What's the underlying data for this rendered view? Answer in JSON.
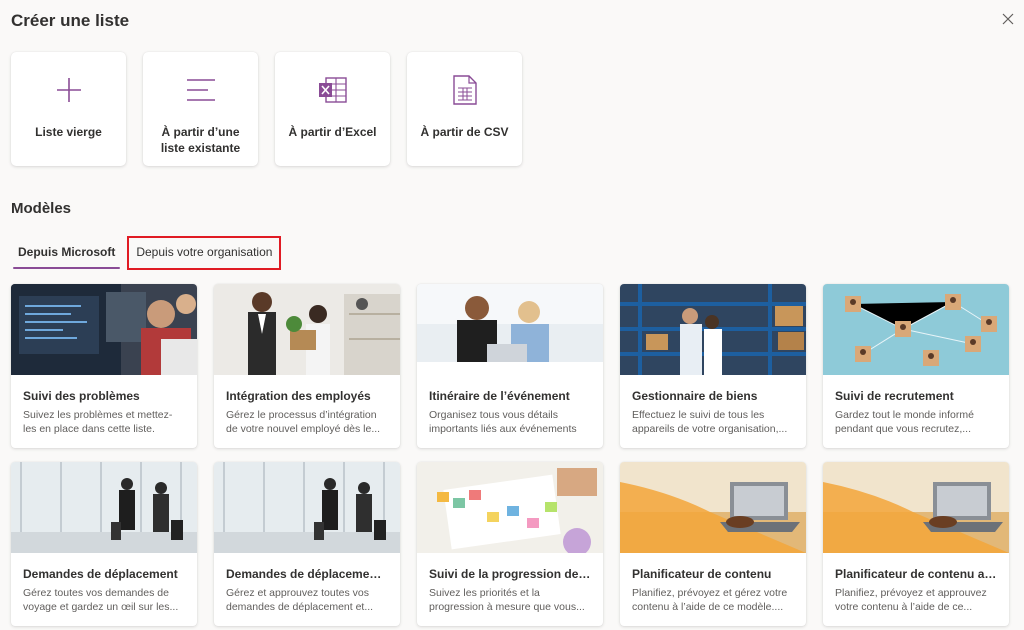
{
  "dialog": {
    "title": "Créer une liste"
  },
  "create_options": [
    {
      "label": "Liste vierge",
      "icon": "plus-icon"
    },
    {
      "label": "À partir d’une\nliste existante",
      "icon": "list-lines-icon"
    },
    {
      "label": "À partir d’Excel",
      "icon": "excel-icon"
    },
    {
      "label": "À partir de CSV",
      "icon": "csv-file-icon"
    }
  ],
  "templates_section": {
    "title": "Modèles"
  },
  "tabs": [
    {
      "label": "Depuis Microsoft",
      "active": true
    },
    {
      "label": "Depuis votre organisation",
      "active": false
    }
  ],
  "templates": [
    {
      "title": "Suivi des problèmes",
      "description": "Suivez les problèmes et mettez-les en place dans cette liste."
    },
    {
      "title": "Intégration des employés",
      "description": "Gérez le processus d’intégration de votre nouvel employé dès le..."
    },
    {
      "title": "Itinéraire de l’événement",
      "description": "Organisez tous vous détails importants liés aux événements a..."
    },
    {
      "title": "Gestionnaire de biens",
      "description": "Effectuez le suivi de tous les appareils de votre organisation,..."
    },
    {
      "title": "Suivi de recrutement",
      "description": "Gardez tout le monde informé pendant que vous recrutez,..."
    },
    {
      "title": "Demandes de déplacement",
      "description": "Gérez toutes vos demandes de voyage et gardez un œil sur les..."
    },
    {
      "title": "Demandes de déplacement...",
      "description": "Gérez et approuvez toutes vos demandes de déplacement et..."
    },
    {
      "title": "Suivi de la progression des ...",
      "description": "Suivez les priorités et la progression à mesure que vous..."
    },
    {
      "title": "Planificateur de contenu",
      "description": "Planifiez, prévoyez et gérez votre contenu à l’aide de ce modèle...."
    },
    {
      "title": "Planificateur de contenu av...",
      "description": "Planifiez, prévoyez et approuvez votre contenu à l’aide de ce..."
    }
  ],
  "colors": {
    "accent": "#8a4c96",
    "highlight_box": "#e01b24"
  }
}
